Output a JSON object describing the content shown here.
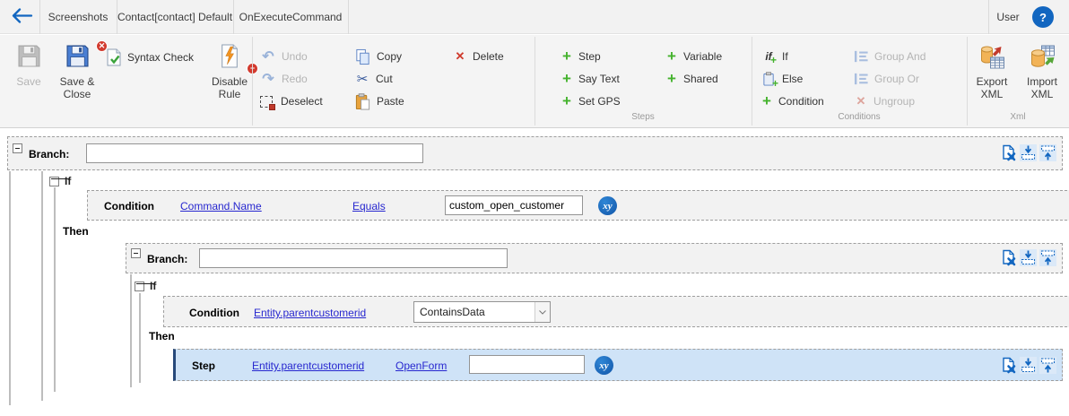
{
  "topbar": {
    "tabs": [
      "Screenshots",
      "Contact[contact] Default",
      "OnExecuteCommand"
    ],
    "user": "User"
  },
  "icons": {
    "plus": "+",
    "undo": "↶",
    "redo": "↷",
    "cut": "✂",
    "delete": "✕",
    "ungroup": "✕",
    "help": "?",
    "if_glyph": "if",
    "xy": "xy"
  },
  "ribbon": {
    "save": "Save",
    "save_close": "Save & Close",
    "syntax_check": "Syntax Check",
    "disable_rule": "Disable Rule",
    "undo": "Undo",
    "redo": "Redo",
    "deselect": "Deselect",
    "copy": "Copy",
    "cut": "Cut",
    "paste": "Paste",
    "delete": "Delete",
    "step": "Step",
    "say_text": "Say Text",
    "set_gps": "Set GPS",
    "variable": "Variable",
    "shared": "Shared",
    "if": "If",
    "else": "Else",
    "condition": "Condition",
    "group_and": "Group And",
    "group_or": "Group Or",
    "ungroup": "Ungroup",
    "export_xml": "Export XML",
    "import_xml": "Import XML",
    "groups": {
      "steps": "Steps",
      "conditions": "Conditions",
      "xml": "Xml"
    }
  },
  "rule_tree": {
    "branch1": {
      "label": "Branch:",
      "value": ""
    },
    "if1": {
      "label": "If"
    },
    "condition1": {
      "label": "Condition",
      "field": "Command.Name",
      "operator": "Equals",
      "value": "custom_open_customer"
    },
    "then1": {
      "label": "Then"
    },
    "branch2": {
      "label": "Branch:",
      "value": ""
    },
    "if2": {
      "label": "If"
    },
    "condition2": {
      "label": "Condition",
      "field": "Entity.parentcustomerid",
      "operator": "ContainsData"
    },
    "then2": {
      "label": "Then"
    },
    "step1": {
      "label": "Step",
      "field": "Entity.parentcustomerid",
      "action": "OpenForm",
      "value": ""
    }
  },
  "colors": {
    "accent_blue": "#1266c0",
    "link_blue": "#2727cf",
    "selected_row": "#cfe3f7",
    "green_plus": "#44b22d",
    "red": "#cf3a2c"
  }
}
